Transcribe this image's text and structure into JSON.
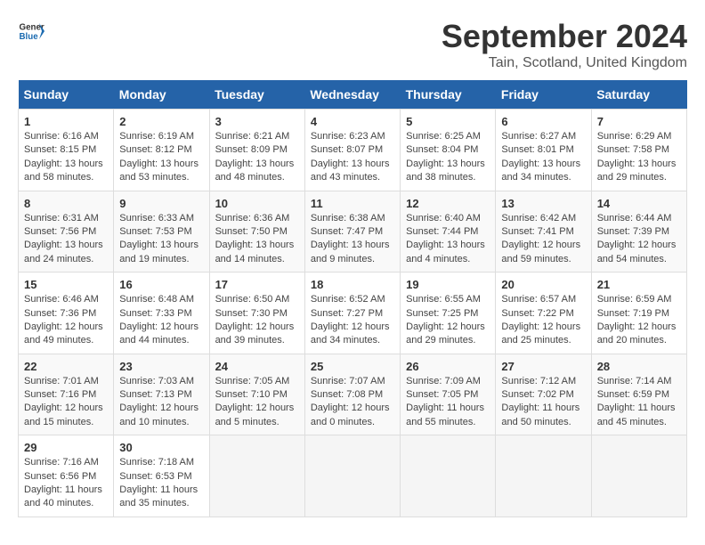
{
  "header": {
    "logo_general": "General",
    "logo_blue": "Blue",
    "title": "September 2024",
    "location": "Tain, Scotland, United Kingdom"
  },
  "days_of_week": [
    "Sunday",
    "Monday",
    "Tuesday",
    "Wednesday",
    "Thursday",
    "Friday",
    "Saturday"
  ],
  "weeks": [
    [
      {
        "day": "1",
        "sunrise": "6:16 AM",
        "sunset": "8:15 PM",
        "daylight": "13 hours and 58 minutes."
      },
      {
        "day": "2",
        "sunrise": "6:19 AM",
        "sunset": "8:12 PM",
        "daylight": "13 hours and 53 minutes."
      },
      {
        "day": "3",
        "sunrise": "6:21 AM",
        "sunset": "8:09 PM",
        "daylight": "13 hours and 48 minutes."
      },
      {
        "day": "4",
        "sunrise": "6:23 AM",
        "sunset": "8:07 PM",
        "daylight": "13 hours and 43 minutes."
      },
      {
        "day": "5",
        "sunrise": "6:25 AM",
        "sunset": "8:04 PM",
        "daylight": "13 hours and 38 minutes."
      },
      {
        "day": "6",
        "sunrise": "6:27 AM",
        "sunset": "8:01 PM",
        "daylight": "13 hours and 34 minutes."
      },
      {
        "day": "7",
        "sunrise": "6:29 AM",
        "sunset": "7:58 PM",
        "daylight": "13 hours and 29 minutes."
      }
    ],
    [
      {
        "day": "8",
        "sunrise": "6:31 AM",
        "sunset": "7:56 PM",
        "daylight": "13 hours and 24 minutes."
      },
      {
        "day": "9",
        "sunrise": "6:33 AM",
        "sunset": "7:53 PM",
        "daylight": "13 hours and 19 minutes."
      },
      {
        "day": "10",
        "sunrise": "6:36 AM",
        "sunset": "7:50 PM",
        "daylight": "13 hours and 14 minutes."
      },
      {
        "day": "11",
        "sunrise": "6:38 AM",
        "sunset": "7:47 PM",
        "daylight": "13 hours and 9 minutes."
      },
      {
        "day": "12",
        "sunrise": "6:40 AM",
        "sunset": "7:44 PM",
        "daylight": "13 hours and 4 minutes."
      },
      {
        "day": "13",
        "sunrise": "6:42 AM",
        "sunset": "7:41 PM",
        "daylight": "12 hours and 59 minutes."
      },
      {
        "day": "14",
        "sunrise": "6:44 AM",
        "sunset": "7:39 PM",
        "daylight": "12 hours and 54 minutes."
      }
    ],
    [
      {
        "day": "15",
        "sunrise": "6:46 AM",
        "sunset": "7:36 PM",
        "daylight": "12 hours and 49 minutes."
      },
      {
        "day": "16",
        "sunrise": "6:48 AM",
        "sunset": "7:33 PM",
        "daylight": "12 hours and 44 minutes."
      },
      {
        "day": "17",
        "sunrise": "6:50 AM",
        "sunset": "7:30 PM",
        "daylight": "12 hours and 39 minutes."
      },
      {
        "day": "18",
        "sunrise": "6:52 AM",
        "sunset": "7:27 PM",
        "daylight": "12 hours and 34 minutes."
      },
      {
        "day": "19",
        "sunrise": "6:55 AM",
        "sunset": "7:25 PM",
        "daylight": "12 hours and 29 minutes."
      },
      {
        "day": "20",
        "sunrise": "6:57 AM",
        "sunset": "7:22 PM",
        "daylight": "12 hours and 25 minutes."
      },
      {
        "day": "21",
        "sunrise": "6:59 AM",
        "sunset": "7:19 PM",
        "daylight": "12 hours and 20 minutes."
      }
    ],
    [
      {
        "day": "22",
        "sunrise": "7:01 AM",
        "sunset": "7:16 PM",
        "daylight": "12 hours and 15 minutes."
      },
      {
        "day": "23",
        "sunrise": "7:03 AM",
        "sunset": "7:13 PM",
        "daylight": "12 hours and 10 minutes."
      },
      {
        "day": "24",
        "sunrise": "7:05 AM",
        "sunset": "7:10 PM",
        "daylight": "12 hours and 5 minutes."
      },
      {
        "day": "25",
        "sunrise": "7:07 AM",
        "sunset": "7:08 PM",
        "daylight": "12 hours and 0 minutes."
      },
      {
        "day": "26",
        "sunrise": "7:09 AM",
        "sunset": "7:05 PM",
        "daylight": "11 hours and 55 minutes."
      },
      {
        "day": "27",
        "sunrise": "7:12 AM",
        "sunset": "7:02 PM",
        "daylight": "11 hours and 50 minutes."
      },
      {
        "day": "28",
        "sunrise": "7:14 AM",
        "sunset": "6:59 PM",
        "daylight": "11 hours and 45 minutes."
      }
    ],
    [
      {
        "day": "29",
        "sunrise": "7:16 AM",
        "sunset": "6:56 PM",
        "daylight": "11 hours and 40 minutes."
      },
      {
        "day": "30",
        "sunrise": "7:18 AM",
        "sunset": "6:53 PM",
        "daylight": "11 hours and 35 minutes."
      },
      null,
      null,
      null,
      null,
      null
    ]
  ]
}
